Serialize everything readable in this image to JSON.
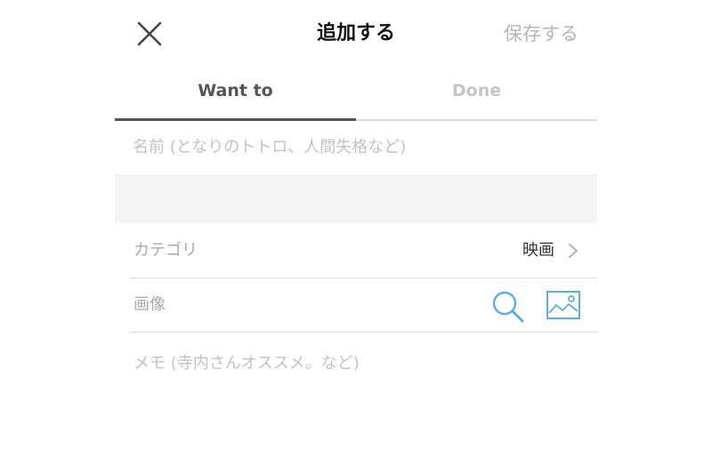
{
  "header": {
    "title": "追加する",
    "save_label": "保存する",
    "close_icon": "close-icon"
  },
  "tabs": [
    {
      "label": "Want to",
      "active": true
    },
    {
      "label": "Done",
      "active": false
    }
  ],
  "name_field": {
    "value": "",
    "placeholder": "名前 (となりのトトロ、人間失格など)"
  },
  "category": {
    "label": "カテゴリ",
    "value": "映画",
    "icon": "chevron-right-icon"
  },
  "image": {
    "label": "画像",
    "search_icon": "search-icon",
    "image_icon": "image-icon"
  },
  "memo_field": {
    "value": "",
    "placeholder": "メモ (寺内さんオススメ。など)"
  },
  "colors": {
    "accent_blue": "#5aaee0",
    "active_tab": "#555555",
    "inactive_text": "#b5b5b5",
    "band": "#f5f5f5"
  }
}
